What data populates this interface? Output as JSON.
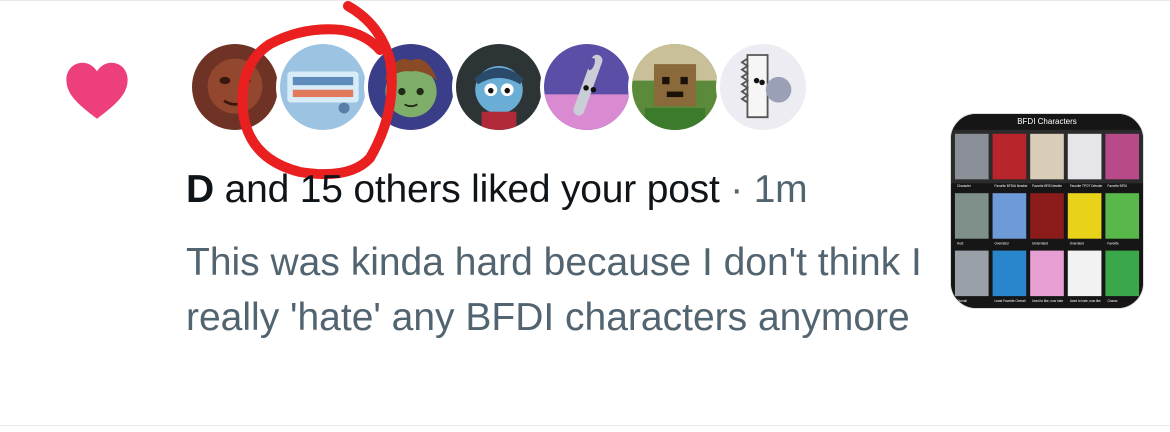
{
  "notification": {
    "type": "like",
    "icon": "heart-icon",
    "accent_color": "#ef3b78",
    "avatars": [
      {
        "name": "avatar-1"
      },
      {
        "name": "avatar-2"
      },
      {
        "name": "avatar-3"
      },
      {
        "name": "avatar-4"
      },
      {
        "name": "avatar-5"
      },
      {
        "name": "avatar-6"
      },
      {
        "name": "avatar-7"
      }
    ],
    "headline": {
      "user": "D",
      "rest": " and 15 others liked your post",
      "separator": " · ",
      "time": "1m"
    },
    "post_text": "This was kinda hard because I don't think I really 'hate' any BFDI characters anymore",
    "thumbnail": {
      "title": "BFDI Characters",
      "captions_row1": [
        "Character",
        "Favorite BFDIA Newbie",
        "Favorite BFB Newbie",
        "Favorite TPOT Debuter",
        "Favorite BFDI"
      ],
      "captions_row2": [
        "Host",
        "Overrated",
        "Underrated",
        "Overrated",
        "Favorite"
      ],
      "captions_row3": [
        "Overall",
        "Least Favorite Overall",
        "Used to like, now hate",
        "Used to hate, now like",
        "Charac"
      ]
    }
  }
}
